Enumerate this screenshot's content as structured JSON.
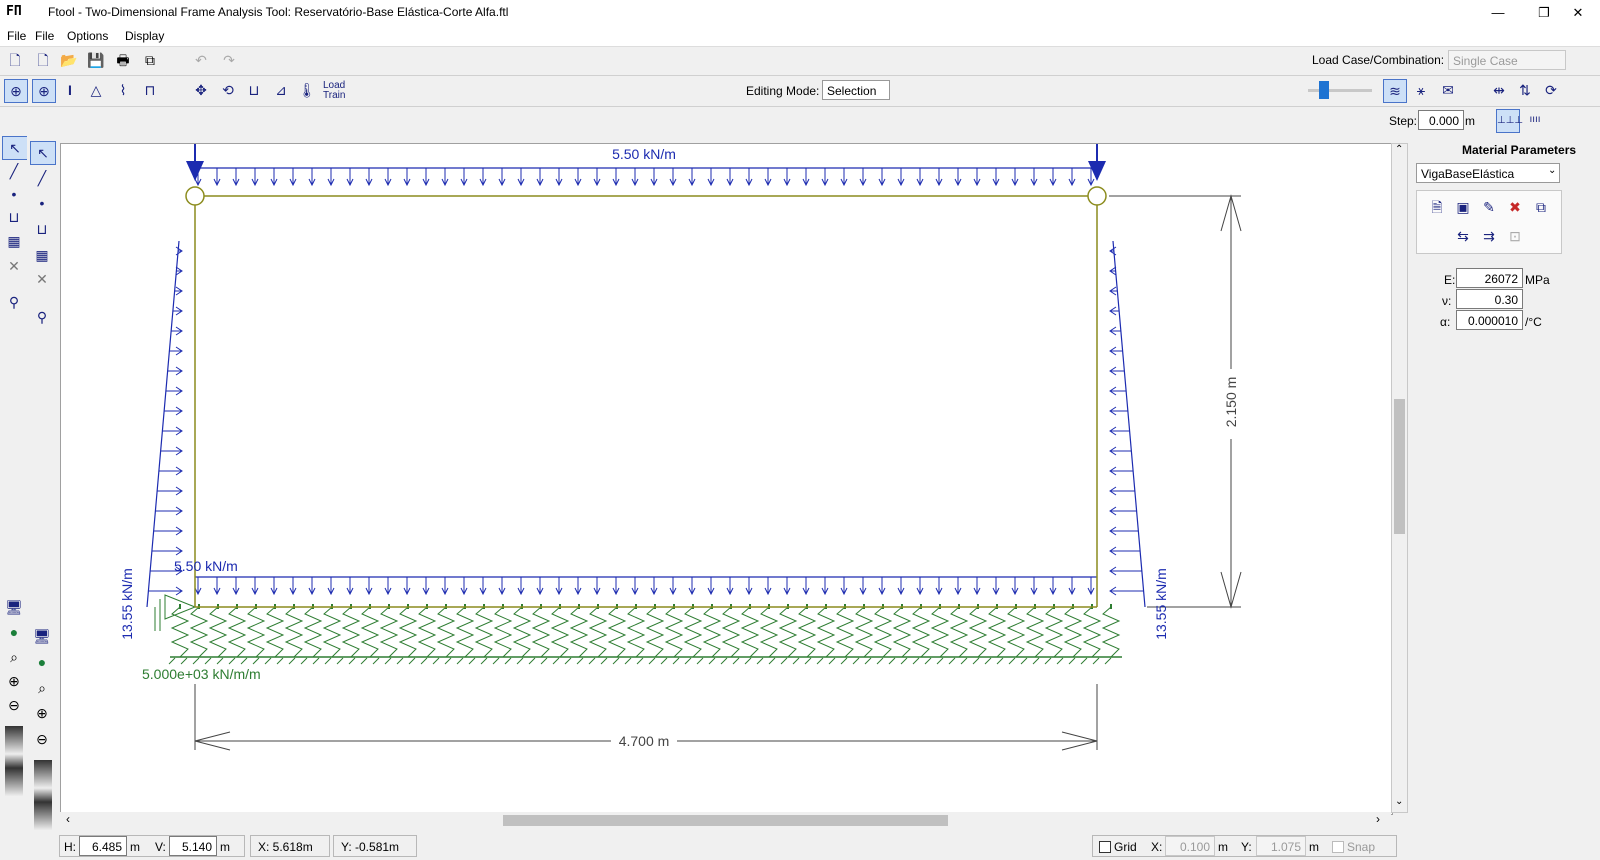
{
  "titlebar": {
    "icon_text": "FΠ",
    "title": "Ftool - Two-Dimensional Frame Analysis Tool: Reservatório-Base Elástica-Corte Alfa.ftl",
    "minimize": "—",
    "restore": "❐",
    "close": "✕"
  },
  "menubar": {
    "items": [
      "File",
      "File",
      "Options",
      "Display"
    ]
  },
  "toolbar1": {
    "load_case_label": "Load Case/Combination:",
    "load_case_value": "Single Case"
  },
  "toolbar2": {
    "editing_mode_label": "Editing Mode:",
    "editing_mode_value": "Selection",
    "load_train_label": "Load Train"
  },
  "toolbar3": {
    "step_label": "Step:",
    "step_value": "0.000",
    "step_unit": "m"
  },
  "right_panel": {
    "title": "Material Parameters",
    "material": "VigaBaseElástica",
    "e_label": "E:",
    "e_value": "26072",
    "e_unit": "MPa",
    "nu_label": "ν:",
    "nu_value": "0.30",
    "alpha_label": "α:",
    "alpha_value": "0.000010",
    "alpha_unit": "/°C"
  },
  "drawing": {
    "top_load_label": "5.50 kN/m",
    "bottom_load_label": "5.50 kN/m",
    "side_load_left_label": "13.55 kN/m",
    "side_load_right_label": "13.55 kN/m",
    "height_dim_label": "2.150 m",
    "width_dim_label": "4.700 m",
    "spring_label": "5.000e+03 kN/m/m",
    "colors": {
      "load": "#1c2bb0",
      "frame": "#8c8c1e",
      "spring": "#2e7d32",
      "dim": "#444444"
    }
  },
  "statusbar": {
    "h_label": "H:",
    "h_value": "6.485",
    "h_unit": "m",
    "v_label": "V:",
    "v_value": "5.140",
    "v_unit": "m",
    "x_coord": "X: 5.618m",
    "y_coord": "Y: -0.581m",
    "grid_label": "Grid",
    "gx_label": "X:",
    "gx_value": "0.100",
    "gx_unit": "m",
    "gy_label": "Y:",
    "gy_value": "1.075",
    "gy_unit": "m",
    "snap_label": "Snap"
  }
}
